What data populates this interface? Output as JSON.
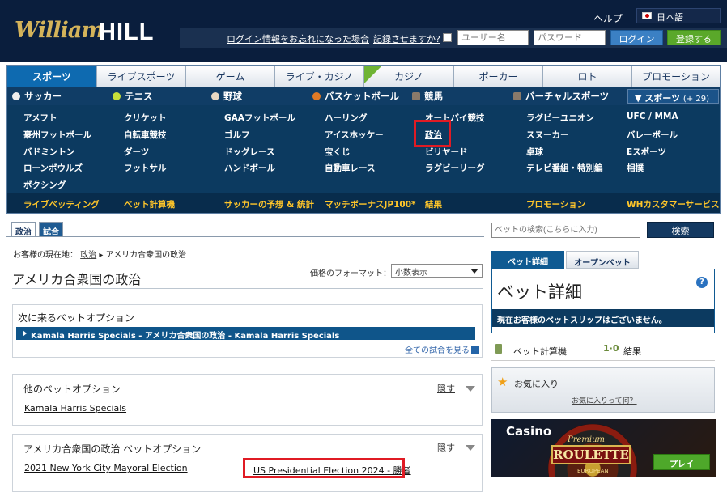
{
  "header": {
    "logo_script": "William",
    "logo_bold": "HILL",
    "help": "ヘルプ",
    "language": "日本語",
    "forgot_login": "ログイン情報をお忘れになった場合",
    "remember": "記録させますか?",
    "username_placeholder": "ユーザー名",
    "password_placeholder": "パスワード",
    "login_button": "ログイン",
    "register_button": "登録する"
  },
  "nav": {
    "tabs": [
      "スポーツ",
      "ライブスポーツ",
      "ゲーム",
      "ライブ・カジノ",
      "カジノ",
      "ポーカー",
      "ロト",
      "プロモーション"
    ],
    "new_badge": "NEW",
    "sports": [
      "サッカー",
      "テニス",
      "野球",
      "バスケットボール",
      "競馬",
      "バーチャルスポーツ"
    ],
    "more_sports": "スポーツ",
    "more_count": "(+ 29)",
    "grid": [
      [
        "アメフト",
        "クリケット",
        "GAAフットボール",
        "ハーリング",
        "オートバイ競技",
        "ラグビーユニオン",
        "UFC / MMA"
      ],
      [
        "豪州フットボール",
        "自転車競技",
        "ゴルフ",
        "アイスホッケー",
        "政治",
        "スヌーカー",
        "バレーボール"
      ],
      [
        "バドミントン",
        "ダーツ",
        "ドッグレース",
        "宝くじ",
        "ビリヤード",
        "卓球",
        "Eスポーツ"
      ],
      [
        "ローンボウルズ",
        "フットサル",
        "ハンドボール",
        "自動車レース",
        "ラグビーリーグ",
        "テレビ番組・特別編",
        "相撲"
      ],
      [
        "ボクシング"
      ]
    ],
    "bottom_links": [
      "ライブベッティング",
      "ベット計算機",
      "サッカーの予想 & 統計",
      "マッチボーナスJP100*",
      "結果",
      "プロモーション",
      "WHカスタマーサービス"
    ]
  },
  "content": {
    "tabs": [
      "政治",
      "試合"
    ],
    "breadcrumb_label": "お客様の現在地：",
    "breadcrumb_link": "政治",
    "breadcrumb_current": "アメリカ合衆国の政治",
    "page_title": "アメリカ合衆国の政治",
    "price_format_label": "価格のフォーマット：",
    "price_format_value": "小数表示",
    "next_bets": {
      "title": "次に来るベットオプション",
      "row": "Kamala Harris Specials - アメリカ合衆国の政治 - Kamala Harris Specials",
      "see_all": "全ての試合を見る"
    },
    "other_bets": {
      "title": "他のベットオプション",
      "hide": "隠す",
      "link": "Kamala Harris Specials"
    },
    "us_bets": {
      "title": "アメリカ合衆国の政治 ベットオプション",
      "hide": "隠す",
      "link1": "2021 New York City Mayoral Election",
      "link2": "US Presidential Election 2024 - 勝者"
    }
  },
  "sidebar": {
    "search_placeholder": "ベットの検索(こちらに入力)",
    "search_button": "検索",
    "tabs": [
      "ベット詳細",
      "オープンベット"
    ],
    "bet_title": "ベット詳細",
    "help_icon": "?",
    "betslip_message": "現在お客様のベットスリップはございません。",
    "calculator": "ベット計算機",
    "results": "結果",
    "favorites_title": "お気に入り",
    "favorites_question": "お気に入りって何？",
    "banner": {
      "casino": "Casino",
      "premium": "Premium",
      "roulette": "ROULETTE",
      "european": "EUROPEAN",
      "play": "プレイ"
    }
  }
}
